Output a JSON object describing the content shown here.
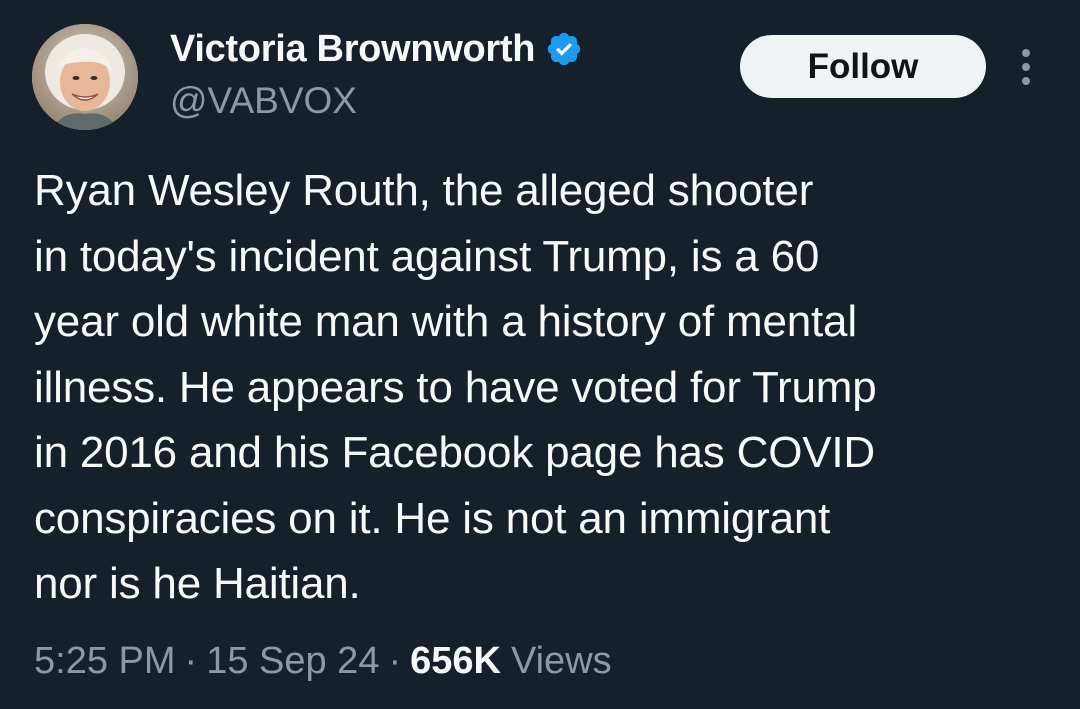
{
  "author": {
    "display_name": "Victoria Brownworth",
    "handle": "@VABVOX",
    "verified": true
  },
  "actions": {
    "follow_label": "Follow",
    "more_icon": "more-vertical-icon"
  },
  "tweet": {
    "text": "Ryan Wesley Routh, the alleged shooter\nin today's incident against Trump, is a 60\nyear old white man with a history of mental\nillness. He appears to have voted for Trump\nin 2016 and his Facebook page has COVID\nconspiracies on it. He is not an immigrant\nnor is he Haitian.",
    "time": "5:25 PM",
    "separator": "·",
    "date": "15 Sep 24",
    "views_count": "656K",
    "views_label": "Views"
  },
  "colors": {
    "background": "#15202b",
    "text": "#f7f9f9",
    "secondary_text": "#8b98a5",
    "verified_badge": "#1d9bf0",
    "follow_button_bg": "#eff3f4"
  }
}
